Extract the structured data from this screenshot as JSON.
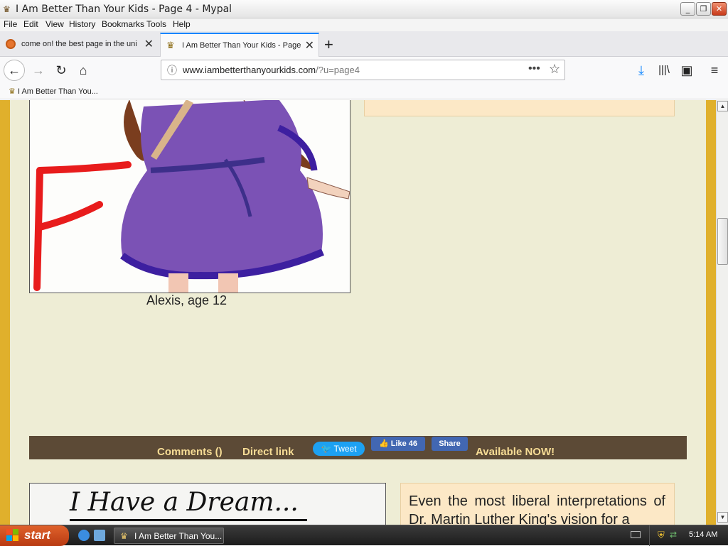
{
  "window": {
    "title": "I Am Better Than Your Kids - Page 4 - Mypal",
    "controls": {
      "minimize": "_",
      "maximize": "❐",
      "close": "✕"
    }
  },
  "menu": [
    "File",
    "Edit",
    "View",
    "History",
    "Bookmarks",
    "Tools",
    "Help"
  ],
  "tabs": [
    {
      "label": "come on! the best page in the uni",
      "active": false
    },
    {
      "label": "I Am Better Than Your Kids - Page",
      "active": true
    }
  ],
  "navbar": {
    "url_domain": "www.iambetterthanyourkids.com",
    "url_path": "/?u=page4"
  },
  "bookmarks": [
    {
      "label": "I Am Better Than You..."
    }
  ],
  "content": {
    "caption": "Alexis, age 12",
    "grade_letter": "F",
    "share_bar": {
      "comments": "Comments ()",
      "direct_link": "Direct link",
      "tweet": "Tweet",
      "like": "Like 46",
      "share": "Share",
      "available": "Available NOW!"
    },
    "dream_title": "I Have a Dream...",
    "peach_text": "Even the most liberal interpretations of Dr. Martin Luther King's vision for a"
  },
  "taskbar": {
    "start": "start",
    "window_label": "I Am Better Than You...",
    "clock": "5:14 AM"
  },
  "colors": {
    "page_bg": "#eeedd5",
    "border_gold": "#e0b02c",
    "share_bar": "#5c4a36",
    "share_text": "#f6dc95",
    "dress_purple": "#7b52b5",
    "dress_trim": "#3d1fa0",
    "grade_red": "#e81c1c"
  }
}
